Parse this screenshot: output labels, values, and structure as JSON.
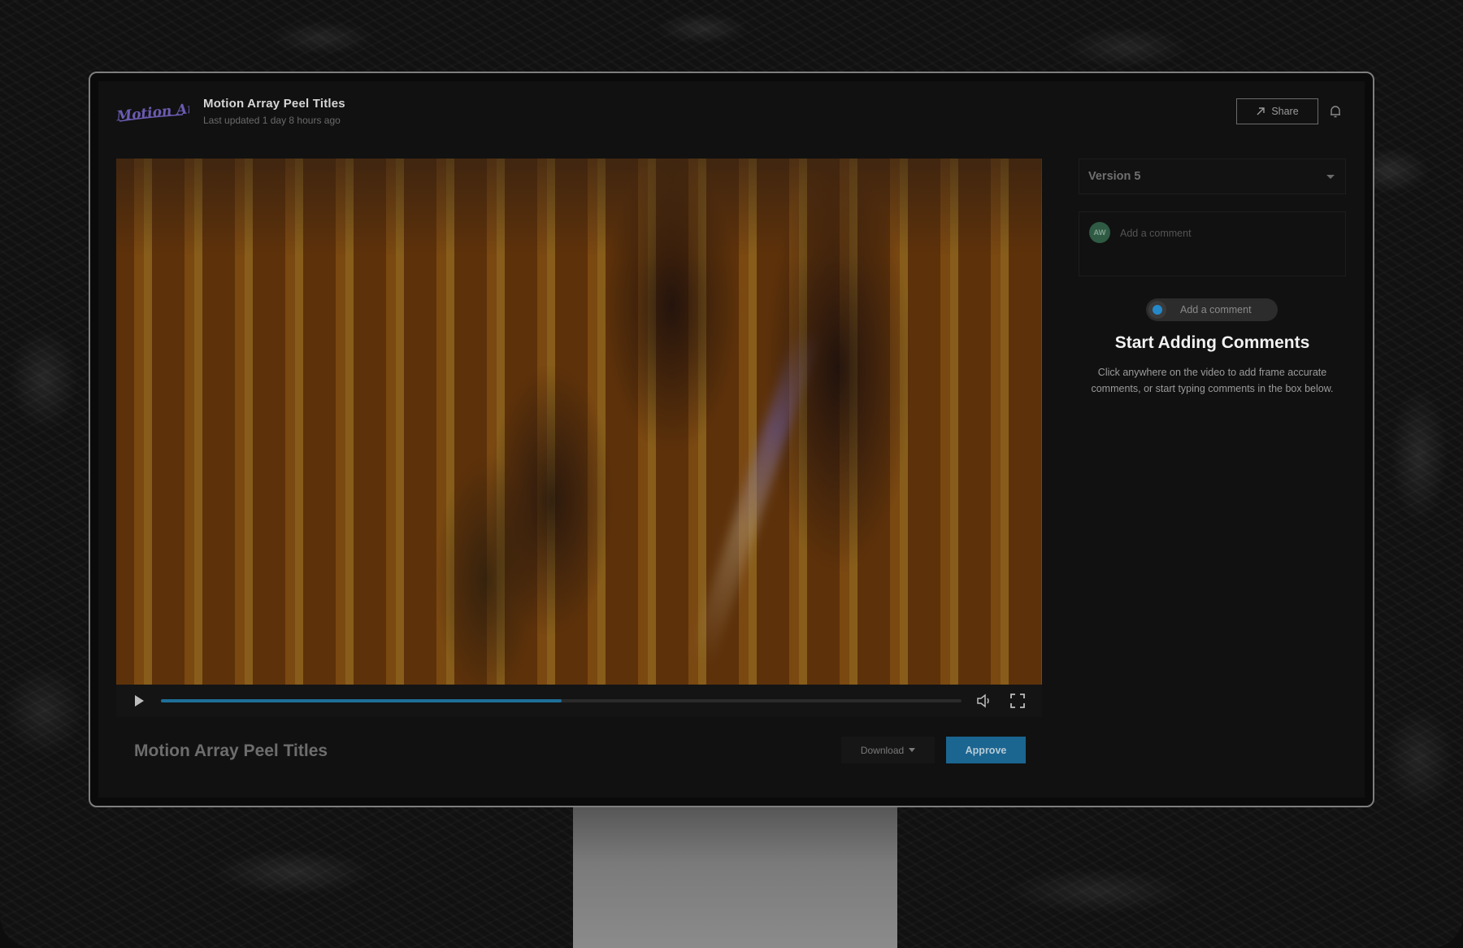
{
  "header": {
    "logo_text": "Motion Array",
    "title": "Motion Array Peel Titles",
    "subtitle": "Last updated 1 day 8 hours ago",
    "share_label": "Share",
    "notification_icon": "bell-icon"
  },
  "player": {
    "progress": 0.5,
    "play_icon": "play-icon",
    "volume_icon": "volume-icon",
    "fullscreen_icon": "fullscreen-icon"
  },
  "footer": {
    "video_title": "Motion Array Peel Titles",
    "download_label": "Download",
    "approve_label": "Approve"
  },
  "sidebar": {
    "version_label": "Version 5",
    "comment_avatar": "AW",
    "comment_placeholder": "Add a comment",
    "hint_label": "Add a comment",
    "empty_title": "Start Adding Comments",
    "empty_description": "Click anywhere on the video to add frame accurate comments, or start typing comments in the box below."
  },
  "colors": {
    "accent": "#1b6591",
    "progress": "#1e6f99",
    "logo": "#6b5bb0",
    "avatar": "#2f5a44"
  }
}
